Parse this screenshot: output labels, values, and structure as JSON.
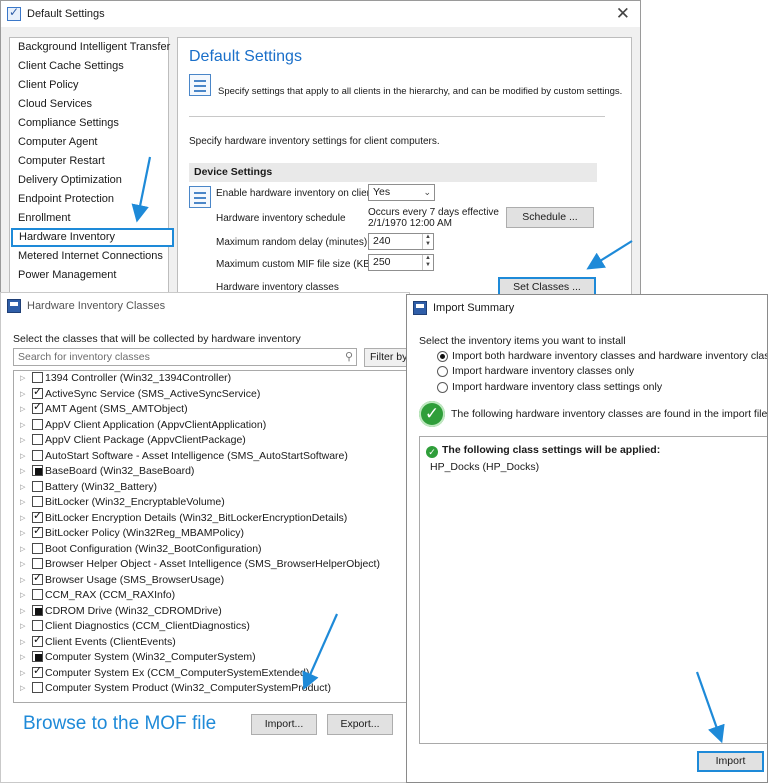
{
  "default_settings": {
    "window_title": "Default Settings",
    "nav_items": [
      "Background Intelligent Transfer",
      "Client Cache Settings",
      "Client Policy",
      "Cloud Services",
      "Compliance Settings",
      "Computer Agent",
      "Computer Restart",
      "Delivery Optimization",
      "Endpoint Protection",
      "Enrollment",
      "Hardware Inventory",
      "Metered Internet Connections",
      "Power Management"
    ],
    "selected_nav": "Hardware Inventory",
    "heading": "Default Settings",
    "description": "Specify settings that apply to all clients in the hierarchy, and can be modified by custom settings.",
    "hw_description": "Specify hardware inventory settings for client computers.",
    "section_title": "Device Settings",
    "enable_label": "Enable hardware inventory on clients",
    "enable_value": "Yes",
    "schedule_label": "Hardware inventory schedule",
    "schedule_line1": "Occurs every 7 days effective",
    "schedule_line2": "2/1/1970 12:00 AM",
    "schedule_button": "Schedule ...",
    "random_delay_label": "Maximum random delay (minutes)",
    "random_delay_value": "240",
    "mif_label": "Maximum custom MIF file size (KB)",
    "mif_value": "250",
    "classes_label": "Hardware inventory classes",
    "set_classes_button": "Set Classes ..."
  },
  "hw_classes": {
    "window_title": "Hardware Inventory Classes",
    "instruction": "Select the classes that will be collected by hardware inventory",
    "search_placeholder": "Search for inventory classes",
    "filter_button": "Filter by c",
    "items": [
      {
        "label": "1394 Controller (Win32_1394Controller)",
        "state": "unchecked"
      },
      {
        "label": "ActiveSync Service (SMS_ActiveSyncService)",
        "state": "checked"
      },
      {
        "label": "AMT Agent (SMS_AMTObject)",
        "state": "checked"
      },
      {
        "label": "AppV Client Application (AppvClientApplication)",
        "state": "unchecked"
      },
      {
        "label": "AppV Client Package (AppvClientPackage)",
        "state": "unchecked"
      },
      {
        "label": "AutoStart Software - Asset Intelligence (SMS_AutoStartSoftware)",
        "state": "unchecked"
      },
      {
        "label": "BaseBoard (Win32_BaseBoard)",
        "state": "partial"
      },
      {
        "label": "Battery (Win32_Battery)",
        "state": "unchecked"
      },
      {
        "label": "BitLocker (Win32_EncryptableVolume)",
        "state": "unchecked"
      },
      {
        "label": "BitLocker Encryption Details (Win32_BitLockerEncryptionDetails)",
        "state": "checked"
      },
      {
        "label": "BitLocker Policy (Win32Reg_MBAMPolicy)",
        "state": "checked"
      },
      {
        "label": "Boot Configuration (Win32_BootConfiguration)",
        "state": "unchecked"
      },
      {
        "label": "Browser Helper Object - Asset Intelligence (SMS_BrowserHelperObject)",
        "state": "unchecked"
      },
      {
        "label": "Browser Usage (SMS_BrowserUsage)",
        "state": "checked"
      },
      {
        "label": "CCM_RAX (CCM_RAXInfo)",
        "state": "unchecked"
      },
      {
        "label": "CDROM Drive (Win32_CDROMDrive)",
        "state": "partial"
      },
      {
        "label": "Client Diagnostics (CCM_ClientDiagnostics)",
        "state": "unchecked"
      },
      {
        "label": "Client Events (ClientEvents)",
        "state": "checked"
      },
      {
        "label": "Computer System (Win32_ComputerSystem)",
        "state": "partial"
      },
      {
        "label": "Computer System Ex (CCM_ComputerSystemExtended)",
        "state": "checked"
      },
      {
        "label": "Computer System Product (Win32_ComputerSystemProduct)",
        "state": "unchecked"
      }
    ],
    "browse_caption": "Browse to the MOF file",
    "import_button": "Import...",
    "export_button": "Export..."
  },
  "import_summary": {
    "window_title": "Import Summary",
    "instruction": "Select the inventory items you want to install",
    "options": [
      "Import both hardware inventory classes and hardware inventory class settings",
      "Import hardware inventory classes only",
      "Import hardware inventory class settings only"
    ],
    "selected_option": 0,
    "found_text": "The following hardware inventory classes are found in the import file:",
    "applied_header": "The following class settings will be applied:",
    "applied_item": "HP_Docks (HP_Docks)",
    "import_button": "Import"
  },
  "colors": {
    "accent": "#1e8ad8",
    "heading": "#1a6fc9",
    "success": "#2f9e3a"
  }
}
